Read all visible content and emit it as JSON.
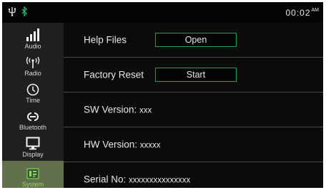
{
  "status": {
    "time": "00:02",
    "ampm": "AM",
    "icons": [
      "usb-icon",
      "bluetooth-icon"
    ]
  },
  "sidebar": {
    "items": [
      {
        "label": "Audio",
        "icon": "audio-bars-icon"
      },
      {
        "label": "Radio",
        "icon": "radio-antenna-icon"
      },
      {
        "label": "Time",
        "icon": "clock-icon"
      },
      {
        "label": "Bluetooth",
        "icon": "link-icon"
      },
      {
        "label": "Display",
        "icon": "monitor-icon"
      },
      {
        "label": "System",
        "icon": "system-icon",
        "active": true
      }
    ]
  },
  "main": {
    "help_files": {
      "label": "Help Files",
      "button": "Open"
    },
    "factory_reset": {
      "label": "Factory Reset",
      "button": "Start"
    },
    "sw_version": {
      "label": "SW Version:",
      "value": "xxx"
    },
    "hw_version": {
      "label": "HW Version:",
      "value": "xxxxx"
    },
    "serial_no": {
      "label": "Serial No:",
      "value": "xxxxxxxxxxxxxxx"
    }
  },
  "colors": {
    "accent_border": "#2f9a5d",
    "active_tab": "#5f6d49",
    "active_label": "#9bd36b",
    "bluetooth": "#2fa866"
  }
}
